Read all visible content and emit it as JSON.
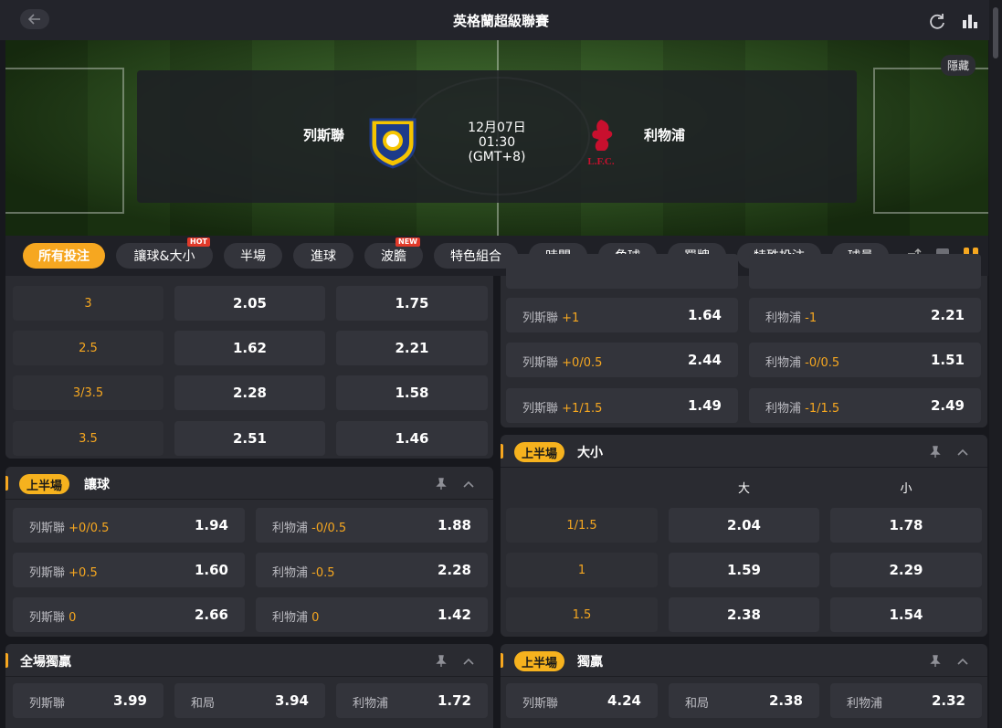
{
  "header": {
    "title": "英格蘭超級聯賽"
  },
  "banner": {
    "hide_label": "隱藏",
    "home_team": "列斯聯",
    "away_team": "利物浦",
    "date": "12月07日",
    "time": "01:30",
    "timezone": "(GMT+8)"
  },
  "tabs": [
    {
      "label": "所有投注",
      "active": true
    },
    {
      "label": "讓球&大小",
      "badge": "HOT"
    },
    {
      "label": "半場"
    },
    {
      "label": "進球"
    },
    {
      "label": "波膽",
      "badge": "NEW"
    },
    {
      "label": "特色組合"
    },
    {
      "label": "時間"
    },
    {
      "label": "角球"
    },
    {
      "label": "罰牌"
    },
    {
      "label": "特殊投注"
    },
    {
      "label": "球員"
    }
  ],
  "ou_full": {
    "rows": [
      {
        "line": "3",
        "over": "2.05",
        "under": "1.75"
      },
      {
        "line": "2.5",
        "over": "1.62",
        "under": "2.21"
      },
      {
        "line": "3/3.5",
        "over": "2.28",
        "under": "1.58"
      },
      {
        "line": "3.5",
        "over": "2.51",
        "under": "1.46"
      }
    ]
  },
  "handicap_full": {
    "rows": [
      {
        "home": "列斯聯",
        "home_hcp": "+1",
        "home_odds": "1.64",
        "away": "利物浦",
        "away_hcp": "-1",
        "away_odds": "2.21"
      },
      {
        "home": "列斯聯",
        "home_hcp": "+0/0.5",
        "home_odds": "2.44",
        "away": "利物浦",
        "away_hcp": "-0/0.5",
        "away_odds": "1.51"
      },
      {
        "home": "列斯聯",
        "home_hcp": "+1/1.5",
        "home_odds": "1.49",
        "away": "利物浦",
        "away_hcp": "-1/1.5",
        "away_odds": "2.49"
      }
    ]
  },
  "handicap_half": {
    "badge": "上半場",
    "title": "讓球",
    "rows": [
      {
        "home": "列斯聯",
        "home_hcp": "+0/0.5",
        "home_odds": "1.94",
        "away": "利物浦",
        "away_hcp": "-0/0.5",
        "away_odds": "1.88"
      },
      {
        "home": "列斯聯",
        "home_hcp": "+0.5",
        "home_odds": "1.60",
        "away": "利物浦",
        "away_hcp": "-0.5",
        "away_odds": "2.28"
      },
      {
        "home": "列斯聯",
        "home_hcp": "0",
        "home_odds": "2.66",
        "away": "利物浦",
        "away_hcp": "0",
        "away_odds": "1.42"
      }
    ]
  },
  "ou_half": {
    "badge": "上半場",
    "title": "大小",
    "col_over": "大",
    "col_under": "小",
    "rows": [
      {
        "line": "1/1.5",
        "over": "2.04",
        "under": "1.78"
      },
      {
        "line": "1",
        "over": "1.59",
        "under": "2.29"
      },
      {
        "line": "1.5",
        "over": "2.38",
        "under": "1.54"
      }
    ]
  },
  "moneyline_full": {
    "title": "全場獨贏",
    "home": "列斯聯",
    "home_odds": "3.99",
    "draw": "和局",
    "draw_odds": "3.94",
    "away": "利物浦",
    "away_odds": "1.72"
  },
  "moneyline_half": {
    "badge": "上半場",
    "title": "獨贏",
    "home": "列斯聯",
    "home_odds": "4.24",
    "draw": "和局",
    "draw_odds": "2.38",
    "away": "利物浦",
    "away_odds": "2.32"
  }
}
